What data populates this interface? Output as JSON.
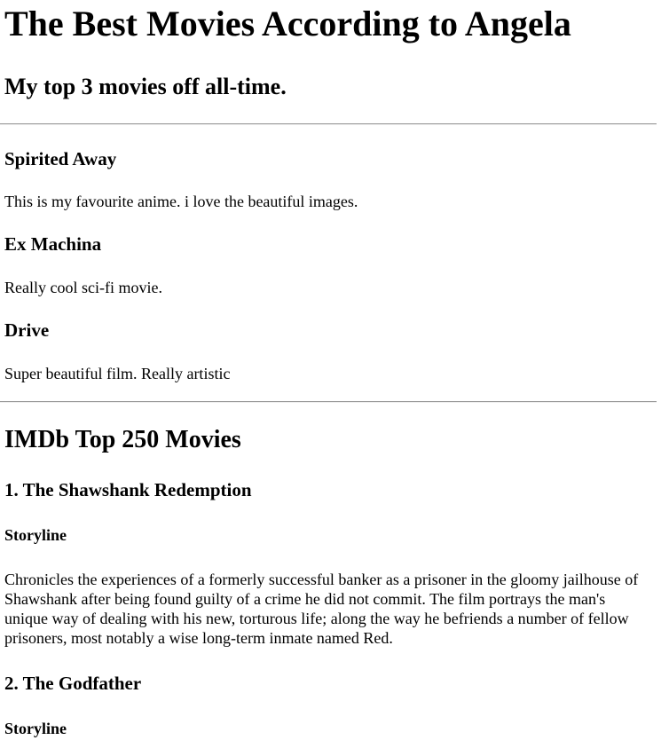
{
  "page": {
    "title": "The Best Movies According to Angela",
    "subtitle": "My top 3 movies off all-time."
  },
  "favourites": [
    {
      "title": "Spirited Away",
      "text": "This is my favourite anime. i love the beautiful images."
    },
    {
      "title": "Ex Machina",
      "text": "Really cool sci-fi movie."
    },
    {
      "title": "Drive",
      "text": "Super beautiful film. Really artistic"
    }
  ],
  "imdb": {
    "heading": "IMDb Top 250 Movies",
    "movies": [
      {
        "title": "1. The Shawshank Redemption",
        "storyline_label": "Storyline",
        "storyline": "Chronicles the experiences of a formerly successful banker as a prisoner in the gloomy jailhouse of Shawshank after being found guilty of a crime he did not commit. The film portrays the man's unique way of dealing with his new, torturous life; along the way he befriends a number of fellow prisoners, most notably a wise long-term inmate named Red."
      },
      {
        "title": "2. The Godfather",
        "storyline_label": "Storyline"
      }
    ]
  }
}
